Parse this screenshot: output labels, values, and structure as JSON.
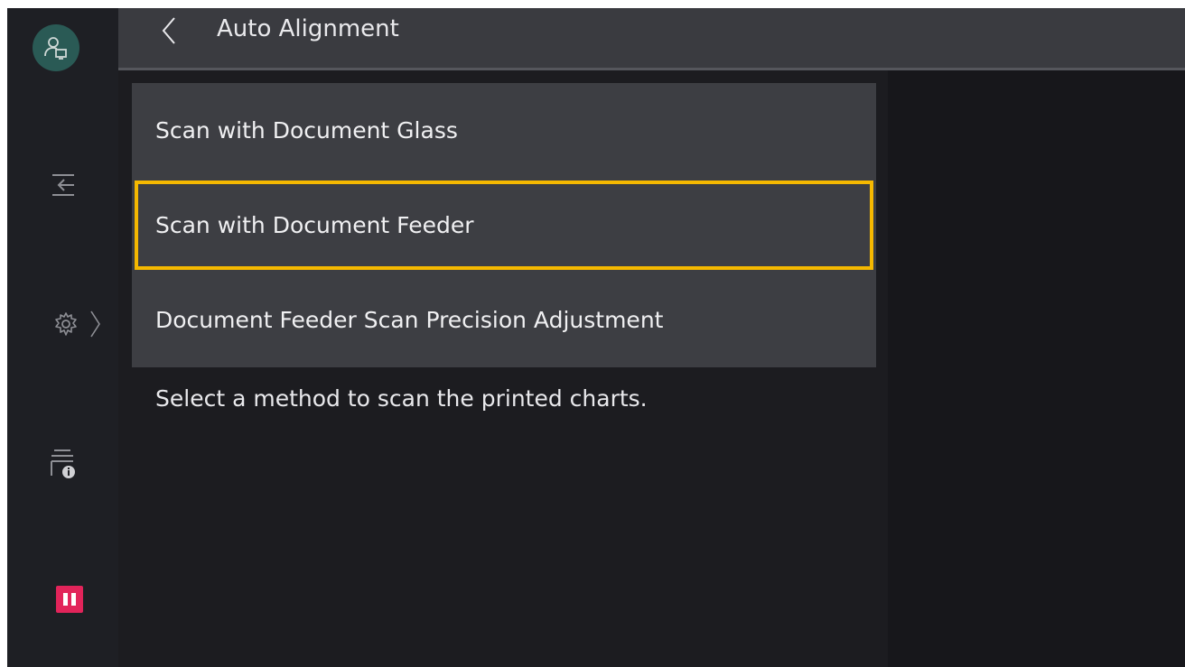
{
  "header": {
    "title": "Auto Alignment",
    "back_icon": "chevron-left-icon"
  },
  "rail": {
    "icons": [
      "user-icon",
      "logout-icon",
      "gear-icon",
      "chevron-right-icon",
      "job-info-icon",
      "pause-icon"
    ]
  },
  "menu": {
    "items": [
      {
        "label": "Scan with Document Glass",
        "selected": false
      },
      {
        "label": "Scan with Document Feeder",
        "selected": true
      },
      {
        "label": "Document Feeder Scan Precision Adjustment",
        "selected": false
      }
    ]
  },
  "hint": "Select a method to scan the printed charts.",
  "colors": {
    "background": "#1c1c20",
    "header": "#3a3b40",
    "menu_item": "#3d3e43",
    "selection": "#f5b800",
    "pause": "#e2245a",
    "user_avatar": "#2a5a55"
  }
}
